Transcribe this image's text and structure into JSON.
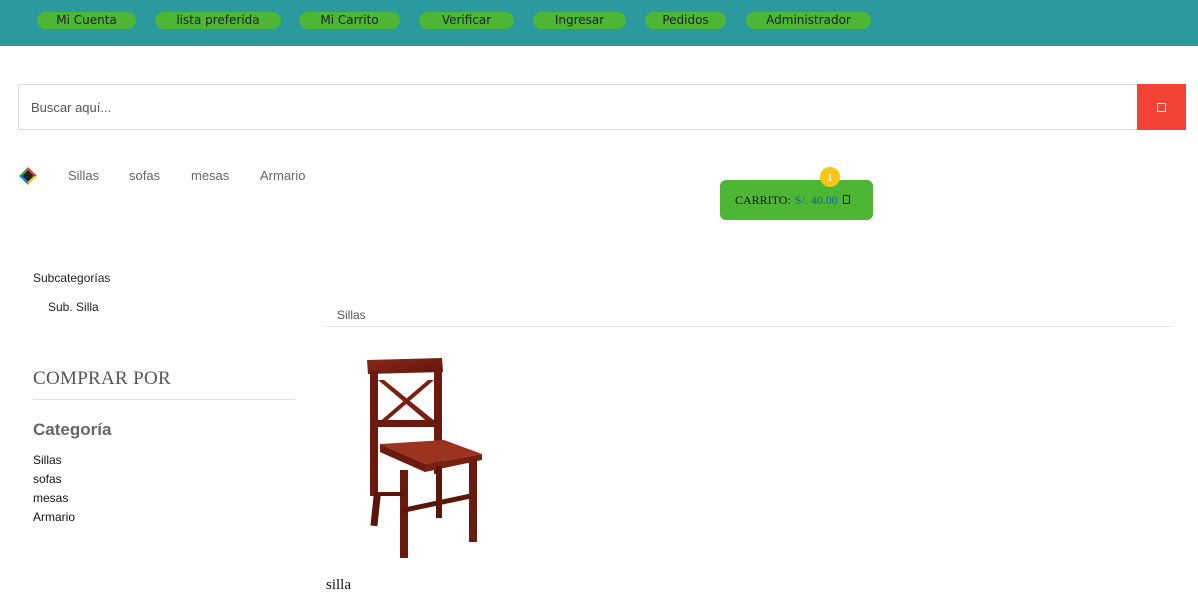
{
  "topnav": {
    "items": [
      {
        "label": "Mi Cuenta"
      },
      {
        "label": "lista preferida"
      },
      {
        "label": "Mi Carrito"
      },
      {
        "label": "Verificar"
      },
      {
        "label": "Ingresar"
      },
      {
        "label": "Pedidos"
      },
      {
        "label": "Administrador"
      }
    ]
  },
  "search": {
    "placeholder": "Buscar aquí...",
    "value": "",
    "button_icon": "search-icon"
  },
  "nav": {
    "logo_icon": "brand-logo-icon",
    "links": [
      {
        "label": "Sillas"
      },
      {
        "label": "sofas"
      },
      {
        "label": "mesas"
      },
      {
        "label": "Armario"
      }
    ]
  },
  "cart": {
    "label": "CARRITO:",
    "amount": "S/. 40.00",
    "count": "1",
    "icon": "shopping-bag-icon"
  },
  "sidebar": {
    "subcategories_title": "Subcategorías",
    "subcategories": [
      {
        "label": "Sub. Silla"
      }
    ],
    "shop_by_title": "COMPRAR POR",
    "category_title": "Categoría",
    "categories": [
      {
        "label": "Sillas"
      },
      {
        "label": "sofas"
      },
      {
        "label": "mesas"
      },
      {
        "label": "Armario"
      }
    ]
  },
  "main": {
    "section_title": "Sillas",
    "products": [
      {
        "name": "silla",
        "image": "wooden-chair-image"
      }
    ]
  },
  "colors": {
    "topbar": "#2a9a9e",
    "pill": "#4db634",
    "search_button": "#f44336",
    "cart": "#4db634",
    "badge": "#f5c518",
    "cart_amount": "#1a5fa0"
  }
}
